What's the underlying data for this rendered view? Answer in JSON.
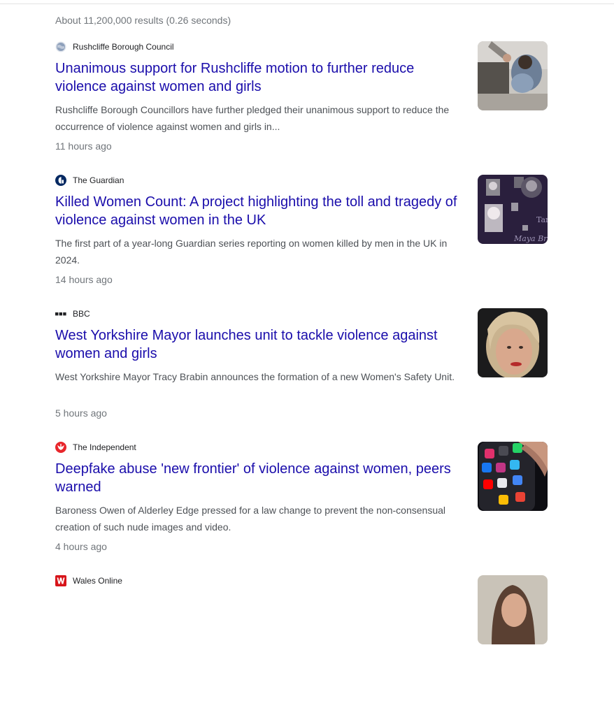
{
  "results_stats": "About 11,200,000 results (0.26 seconds)",
  "news": [
    {
      "source": "Rushcliffe Borough Council",
      "favicon": "globe-icon",
      "title": "Unanimous support for Rushcliffe motion to further reduce violence against women and girls",
      "snippet": "Rushcliffe Borough Councillors have further pledged their unanimous support to reduce the occurrence of violence against women and girls in...",
      "time": "11 hours ago",
      "thumbnail": "distressed-woman-photo"
    },
    {
      "source": "The Guardian",
      "favicon": "guardian-icon",
      "title": "Killed Women Count: A project highlighting the toll and tragedy of violence against women in the UK",
      "snippet": "The first part of a year-long Guardian series reporting on women killed by men in the UK in 2024.",
      "time": "14 hours ago",
      "thumbnail": "portrait-collage-photo",
      "thumbnail_text": [
        "Tara",
        "Maya Brack"
      ]
    },
    {
      "source": "BBC",
      "favicon": "bbc-icon",
      "title": "West Yorkshire Mayor launches unit to tackle violence against women and girls",
      "snippet": "West Yorkshire Mayor Tracy Brabin announces the formation of a new Women's Safety Unit.",
      "time": "5 hours ago",
      "thumbnail": "mayor-portrait-photo"
    },
    {
      "source": "The Independent",
      "favicon": "independent-icon",
      "title": "Deepfake abuse 'new frontier' of violence against women, peers warned",
      "snippet": "Baroness Owen of Alderley Edge pressed for a law change to prevent the non-consensual creation of such nude images and video.",
      "time": "4 hours ago",
      "thumbnail": "smartphone-apps-photo"
    },
    {
      "source": "Wales Online",
      "favicon": "wales-online-icon",
      "title": "",
      "snippet": "",
      "time": "",
      "thumbnail": "woman-portrait-photo"
    }
  ],
  "colors": {
    "link": "#1a0dab",
    "snippet": "#4d5156",
    "meta": "#70757a",
    "independent_red": "#e8262b",
    "wales_online_red": "#d7141a",
    "guardian_navy": "#052962"
  }
}
